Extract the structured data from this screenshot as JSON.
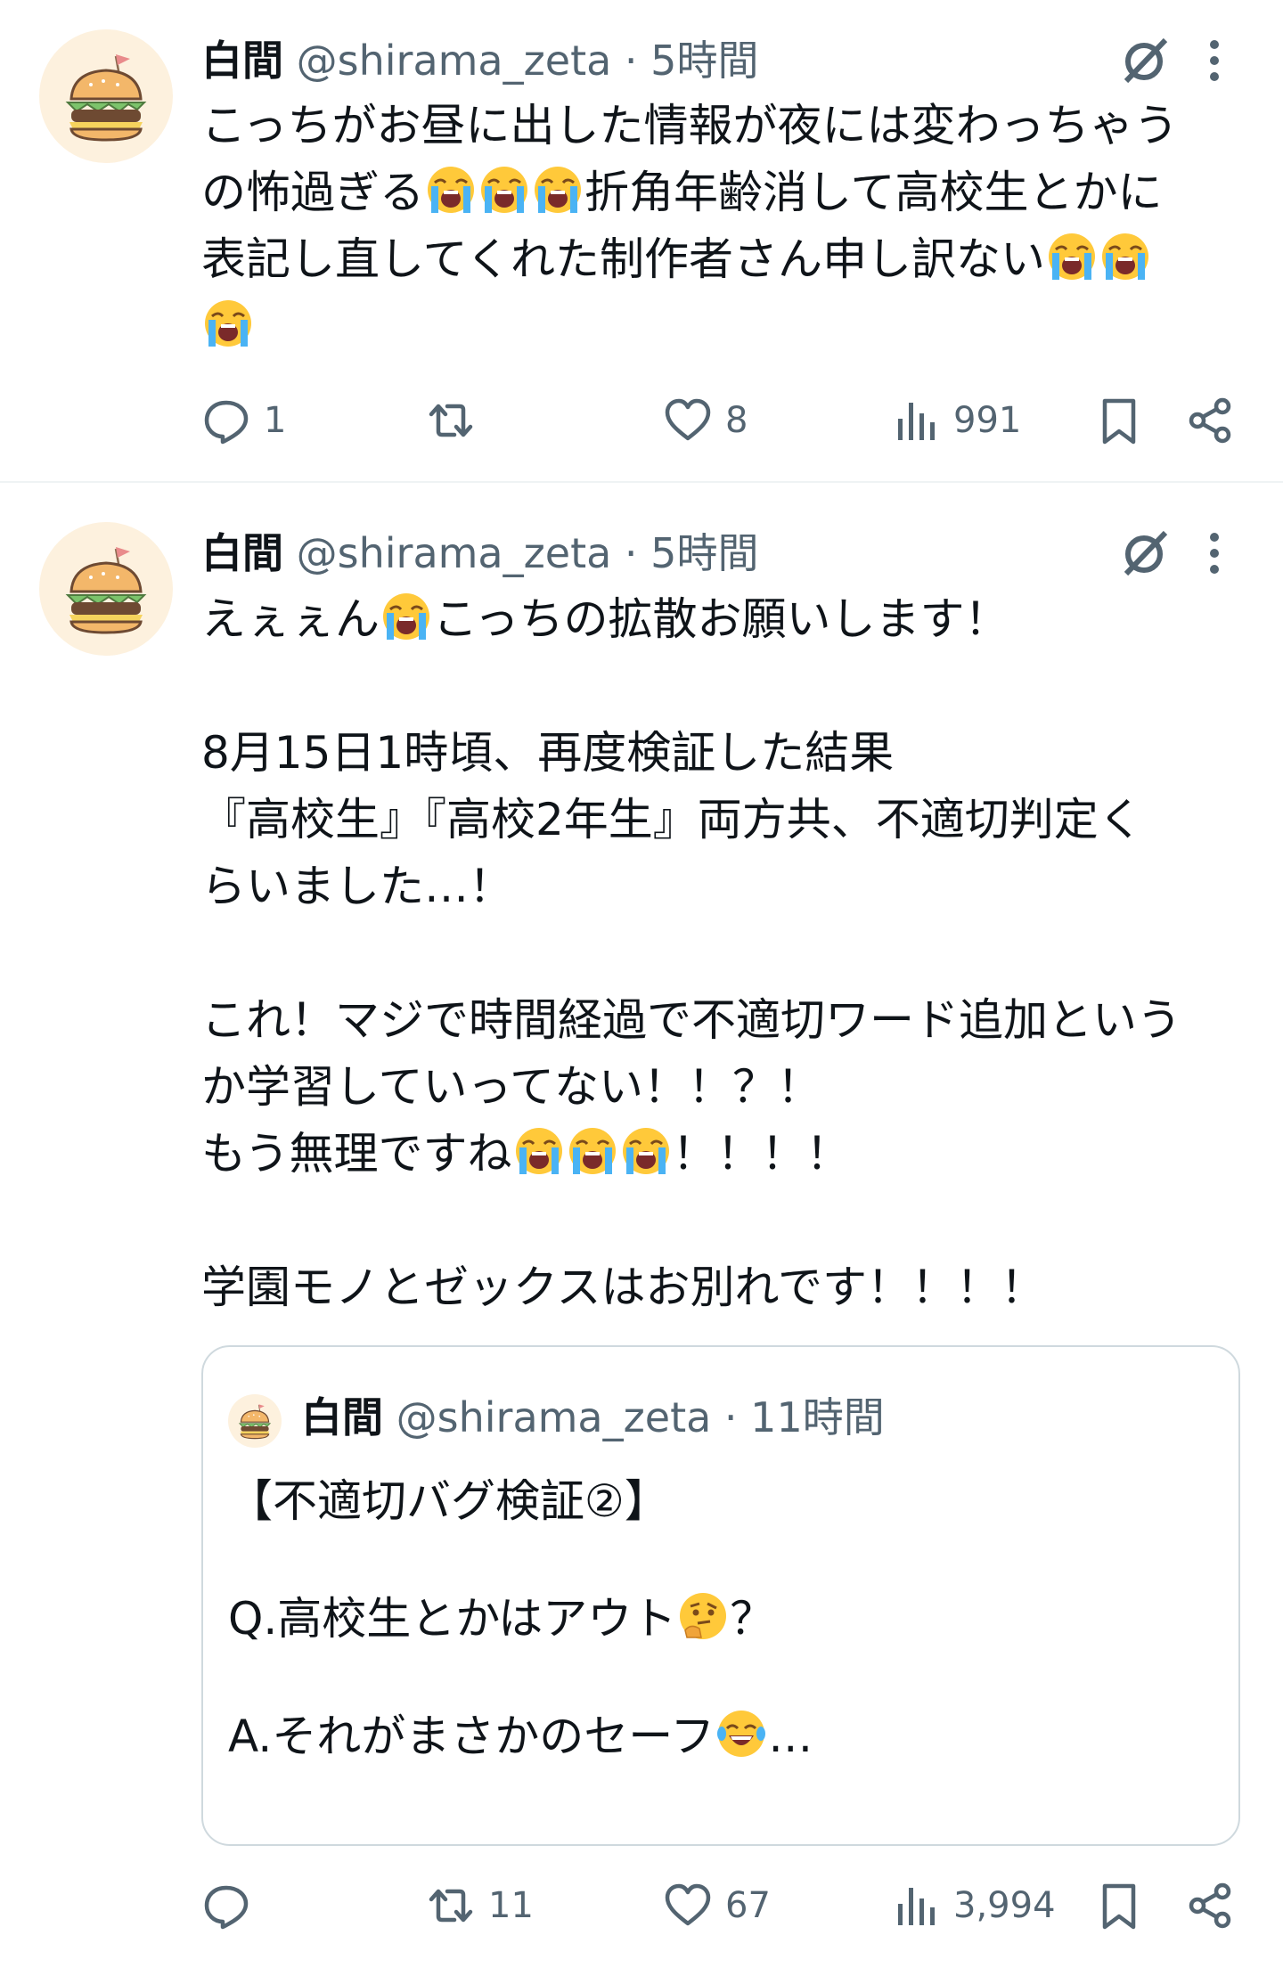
{
  "tweets": [
    {
      "name": "白間",
      "handle": "@shirama_zeta",
      "dot": " · ",
      "time": "5時間",
      "line1": "こっちがお昼に出した情報が夜には変わっちゃう",
      "line2a": "の怖過ぎる",
      "line2b": "折角年齢消して高校生とかに",
      "line3": "表記し直してくれた制作者さん申し訳ない",
      "replies": "1",
      "retweets": "",
      "likes": "8",
      "views": "991"
    },
    {
      "name": "白間",
      "handle": "@shirama_zeta",
      "dot": " · ",
      "time": "5時間",
      "line1a": "えぇぇん",
      "line1b": "こっちの拡散お願いします！",
      "line2": "8月15日1時頃、再度検証した結果",
      "line3": "『高校生』『高校2年生』両方共、不適切判定く",
      "line4": "らいました…！",
      "line5": "これ！マジで時間経過で不適切ワード追加という",
      "line6": "か学習していってない！！？！",
      "line7a": "もう無理ですね",
      "line7b": "！！！！",
      "line8": "学園モノとゼックスはお別れです！！！！",
      "replies": "",
      "retweets": "11",
      "likes": "67",
      "views": "3,994"
    }
  ],
  "quote": {
    "name": "白間",
    "handle": "@shirama_zeta",
    "dot": " · ",
    "time": "11時間",
    "line1": "【不適切バグ検証②】",
    "line2a": "Q.高校生とかはアウト",
    "line2b": "？",
    "line3a": "A.それがまさかのセーフ",
    "line3b": "…"
  },
  "icons": {
    "avatar": "hamburger-avatar-icon",
    "grok": "grok-icon",
    "more": "more-icon",
    "reply": "reply-icon",
    "retweet": "retweet-icon",
    "like": "heart-icon",
    "views": "views-icon",
    "bookmark": "bookmark-icon",
    "share": "share-icon",
    "crying": "loudly-crying-face-emoji",
    "thinking": "thinking-face-emoji",
    "laughing": "tears-of-joy-emoji"
  },
  "colors": {
    "text": "#0f1419",
    "secondary": "#536471",
    "border": "#cfd9de",
    "divider": "#eff3f4",
    "avatar_bg": "#fdf1de"
  }
}
